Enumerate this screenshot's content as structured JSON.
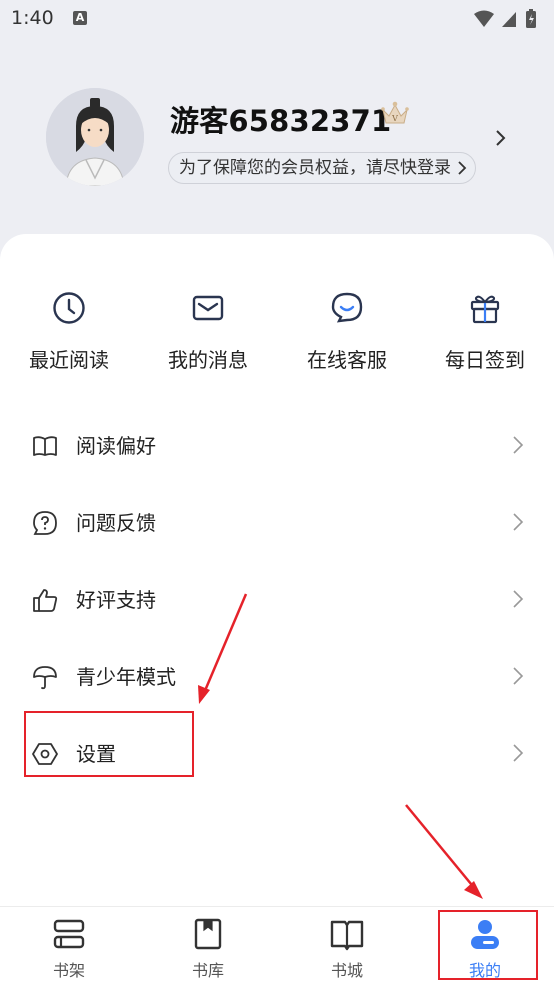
{
  "status_bar": {
    "time": "1:40",
    "notification_icon": "A"
  },
  "profile": {
    "username": "游客65832371",
    "login_tip": "为了保障您的会员权益，请尽快登录",
    "avatar_icon": "avatar-icon",
    "vip_icon": "crown-icon"
  },
  "quick_actions": [
    {
      "label": "最近阅读",
      "icon": "clock-icon"
    },
    {
      "label": "我的消息",
      "icon": "envelope-icon"
    },
    {
      "label": "在线客服",
      "icon": "chat-smile-icon"
    },
    {
      "label": "每日签到",
      "icon": "gift-icon"
    }
  ],
  "menu": [
    {
      "label": "阅读偏好",
      "icon": "book-open-icon"
    },
    {
      "label": "问题反馈",
      "icon": "question-icon"
    },
    {
      "label": "好评支持",
      "icon": "thumbs-up-icon"
    },
    {
      "label": "青少年模式",
      "icon": "umbrella-icon"
    },
    {
      "label": "设置",
      "icon": "hexagon-settings-icon"
    }
  ],
  "bottom_nav": [
    {
      "label": "书架",
      "icon": "bookshelf-icon"
    },
    {
      "label": "书库",
      "icon": "book-icon"
    },
    {
      "label": "书城",
      "icon": "open-book-icon"
    },
    {
      "label": "我的",
      "icon": "profile-icon",
      "active": true
    }
  ],
  "colors": {
    "accent": "#3b7ef5",
    "annotation": "#e5222a",
    "header_bg": "#edeef3"
  }
}
